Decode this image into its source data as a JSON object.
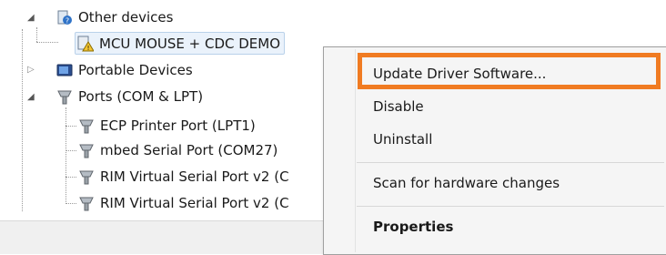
{
  "tree": {
    "other_devices": "Other devices",
    "mcu_device": "MCU MOUSE + CDC DEMO",
    "portable_devices": "Portable Devices",
    "ports": "Ports (COM & LPT)",
    "ecp_port": "ECP Printer Port (LPT1)",
    "mbed_port": "mbed Serial Port (COM27)",
    "rim_port_1": "RIM Virtual Serial Port v2 (C",
    "rim_port_2": "RIM Virtual Serial Port v2 (C"
  },
  "context_menu": {
    "update_driver": "Update Driver Software...",
    "disable": "Disable",
    "uninstall": "Uninstall",
    "scan": "Scan for hardware changes",
    "properties": "Properties"
  },
  "colors": {
    "highlight_border": "#f07b22",
    "selection_bg": "#eaf2fb"
  },
  "icons": {
    "unknown_device": "question-device-icon",
    "warning_device": "warning-device-icon",
    "portable": "portable-device-icon",
    "port": "port-connector-icon"
  }
}
